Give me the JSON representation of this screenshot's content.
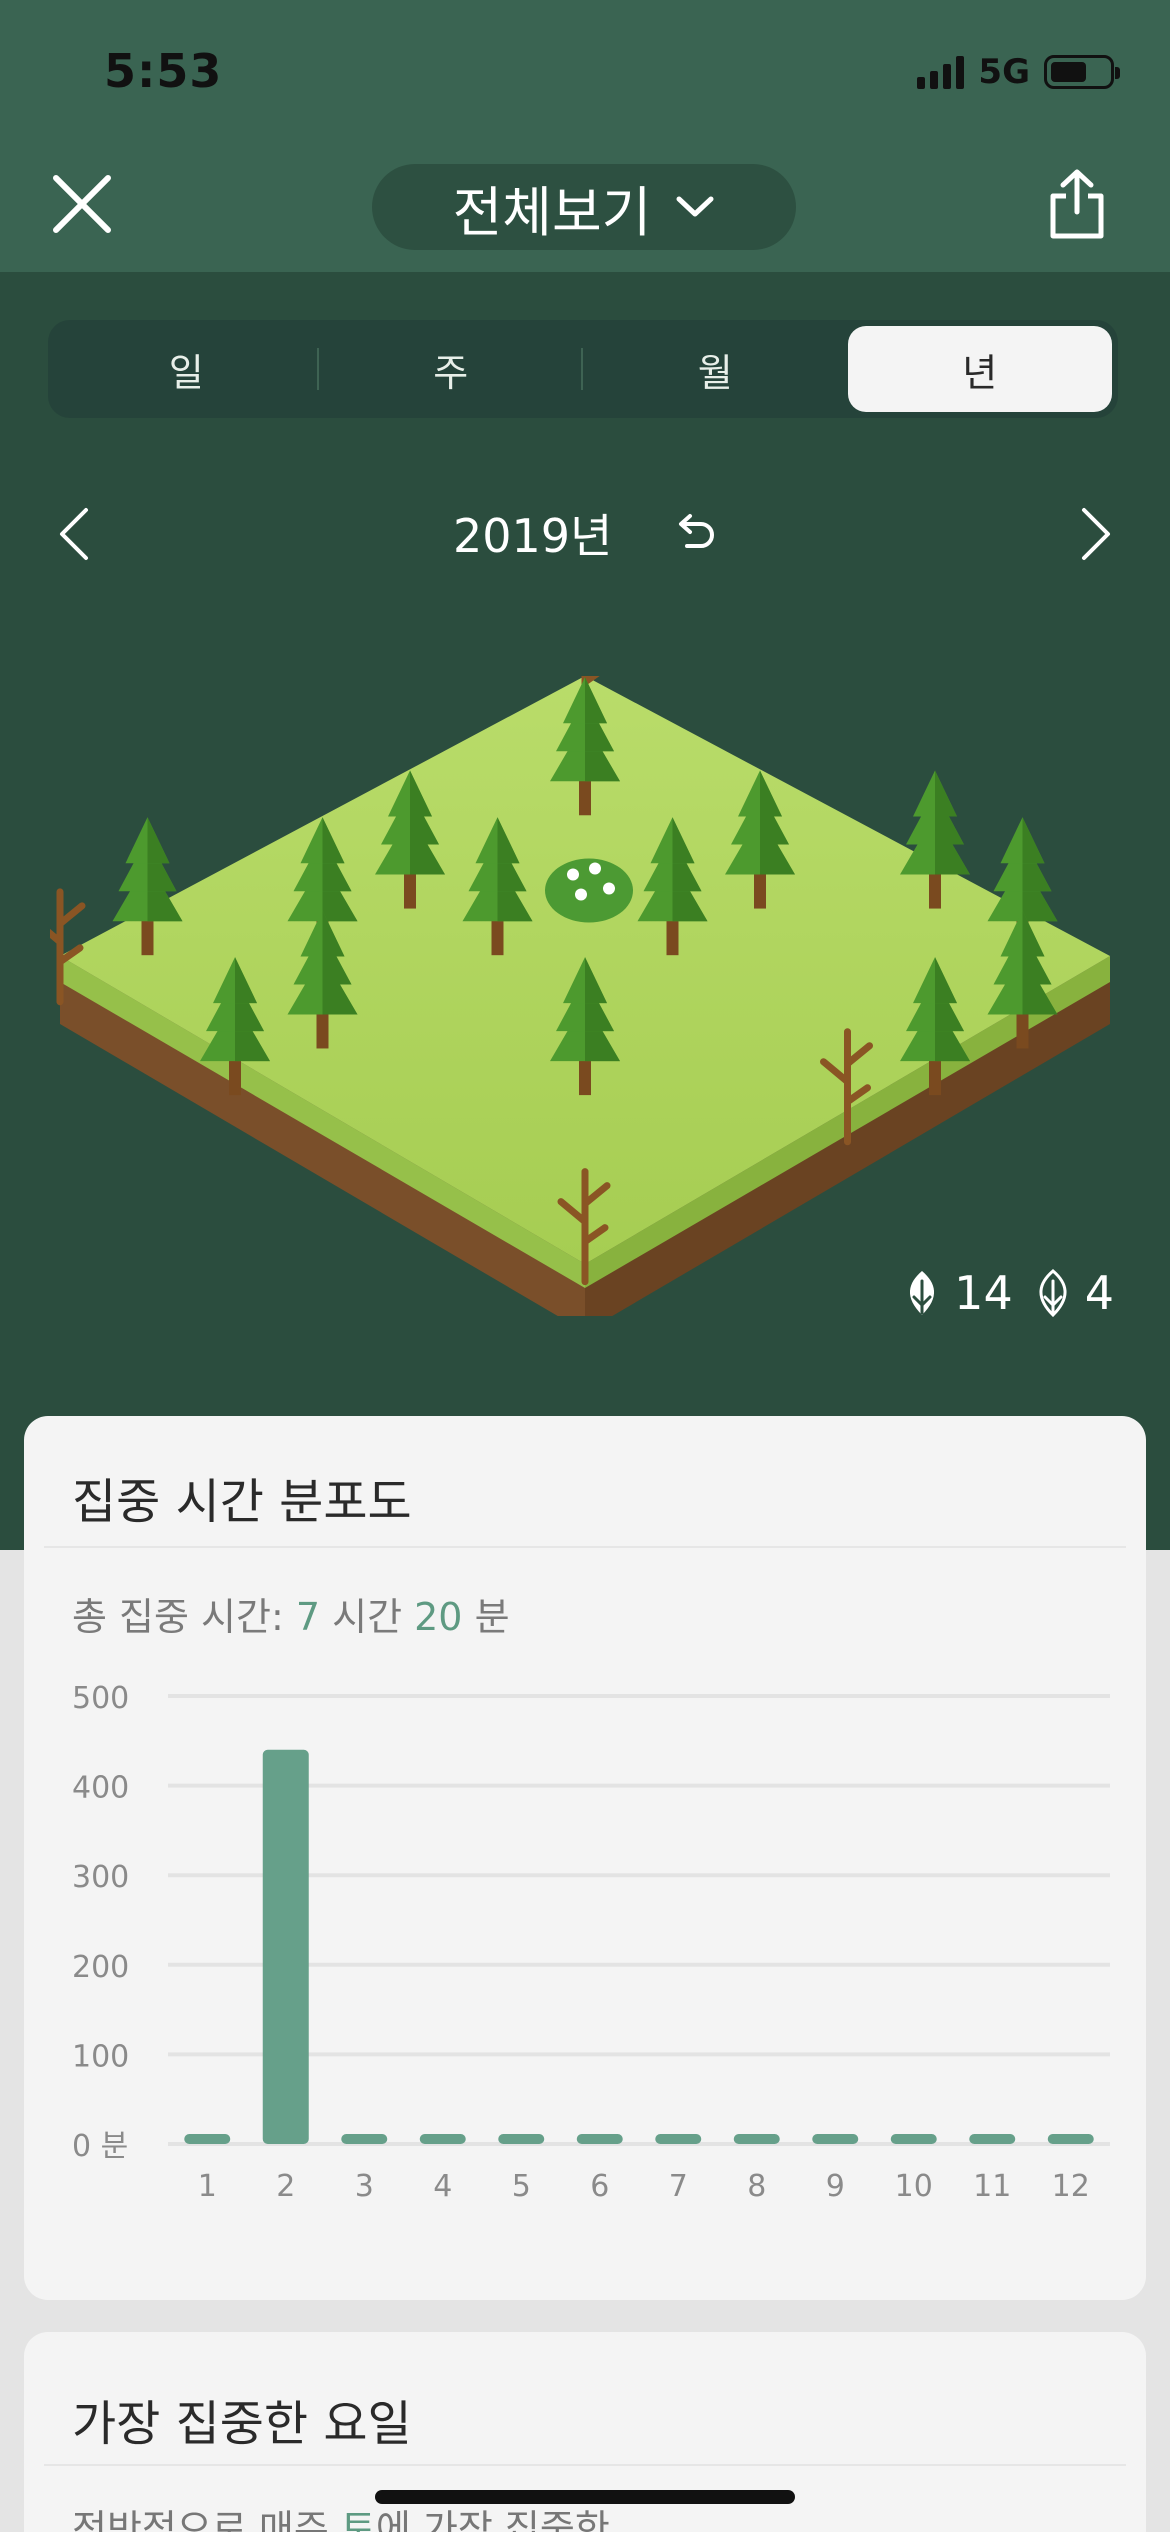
{
  "status": {
    "time": "5:53",
    "network": "5G"
  },
  "header": {
    "title": "전체보기"
  },
  "tabs": [
    {
      "label": "일",
      "active": false
    },
    {
      "label": "주",
      "active": false
    },
    {
      "label": "월",
      "active": false
    },
    {
      "label": "년",
      "active": true
    }
  ],
  "period": {
    "label": "2019년"
  },
  "forest_counts": {
    "healthy": "14",
    "dead": "4"
  },
  "focus_card": {
    "title": "집중 시간 분포도",
    "total_prefix": "총 집중 시간: ",
    "hours": "7",
    "hours_unit": " 시간 ",
    "minutes": "20",
    "minutes_unit": " 분"
  },
  "chart_data": {
    "type": "bar",
    "categories": [
      "1",
      "2",
      "3",
      "4",
      "5",
      "6",
      "7",
      "8",
      "9",
      "10",
      "11",
      "12"
    ],
    "values": [
      0,
      440,
      0,
      0,
      0,
      0,
      0,
      0,
      0,
      0,
      0,
      0
    ],
    "ylim": [
      0,
      500
    ],
    "yticks": [
      "0 분",
      "100",
      "200",
      "300",
      "400",
      "500"
    ],
    "grid": true,
    "color": "#66a08a"
  },
  "weekday_card": {
    "title": "가장 집중한 요일",
    "text_prefix": "전반적으로 매주 ",
    "day": "토",
    "text_suffix": "에 가장 집중한"
  },
  "colors": {
    "header": "#3a6452",
    "dark_bg": "#2b4d3e",
    "accent": "#5e9a82"
  }
}
